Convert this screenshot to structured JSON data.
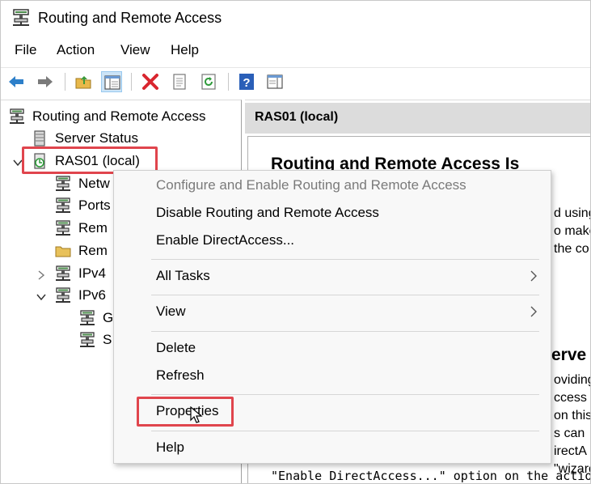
{
  "window": {
    "title": "Routing and Remote Access"
  },
  "menubar": {
    "items": [
      "File",
      "Action",
      "View",
      "Help"
    ]
  },
  "toolbar": {
    "buttons": [
      "back-arrow-icon",
      "forward-arrow-icon",
      "up-folder-icon",
      "show-hide-tree-icon",
      "delete-icon",
      "properties-sheet-icon",
      "refresh-icon",
      "help-icon",
      "action-pane-icon"
    ]
  },
  "tree": {
    "root": "Routing and Remote Access",
    "server_status": "Server Status",
    "server": "RAS01 (local)",
    "children": [
      "Netw",
      "Ports",
      "Rem",
      "Rem",
      "IPv4",
      "IPv6"
    ],
    "ipv6_children": [
      "G",
      "S"
    ]
  },
  "result": {
    "header": "RAS01 (local)",
    "heading": "Routing and Remote Access Is",
    "heading2": "erve",
    "fragments1": [
      "d using",
      "o make",
      "the co"
    ],
    "fragments2": [
      "oviding",
      "ccess",
      "on this",
      "s can",
      "irectA",
      "\"wizard"
    ],
    "bottom_line": "\"Enable DirectAccess...\" option on the action"
  },
  "context_menu": {
    "items": [
      {
        "label": "Configure and Enable Routing and Remote Access",
        "disabled": true
      },
      {
        "label": "Disable Routing and Remote Access"
      },
      {
        "label": "Enable DirectAccess..."
      },
      {
        "label": "All Tasks",
        "submenu": true
      },
      {
        "label": "View",
        "submenu": true
      },
      {
        "label": "Delete"
      },
      {
        "label": "Refresh"
      },
      {
        "label": "Properties"
      },
      {
        "label": "Help"
      }
    ]
  },
  "colors": {
    "highlight": "#e0454d",
    "header_bg": "#dcdcdc",
    "menu_bg": "#f8f8f8"
  }
}
